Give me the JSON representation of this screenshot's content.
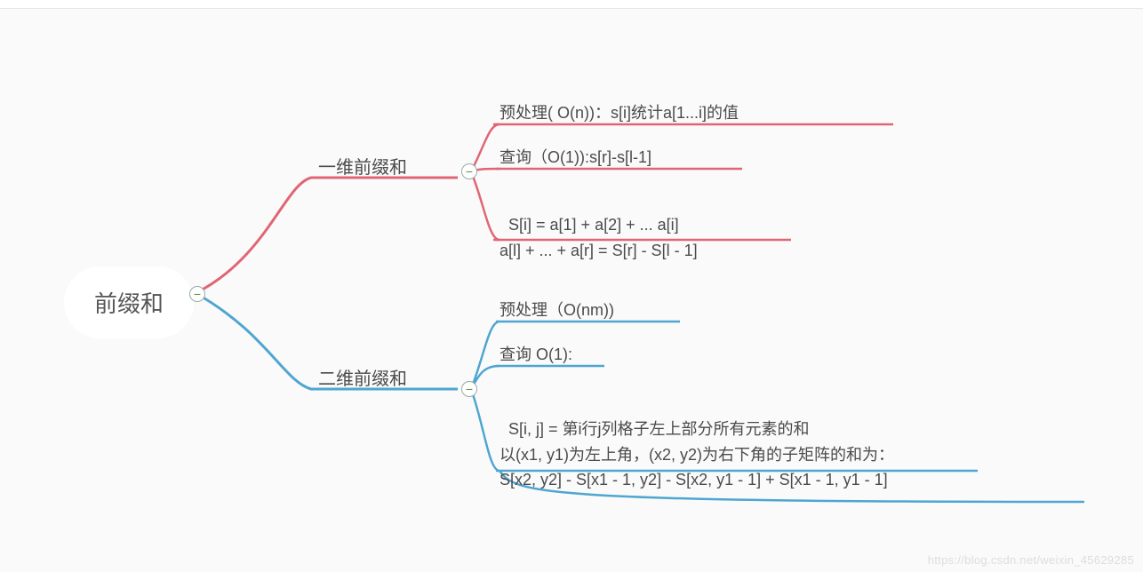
{
  "root": {
    "label": "前缀和"
  },
  "branch1": {
    "label": "一维前缀和",
    "color": "#e06675",
    "leaves": [
      "预处理( O(n))：s[i]统计a[1...i]的值",
      "查询（O(1)):s[r]-s[l-1]",
      "S[i] = a[1] + a[2] + ... a[i]\na[l] + ... + a[r] = S[r] - S[l - 1]"
    ]
  },
  "branch2": {
    "label": "二维前缀和",
    "color": "#4ea6d1",
    "leaves": [
      "预处理（O(nm))",
      "查询 O(1):",
      "S[i, j] = 第i行j列格子左上部分所有元素的和\n以(x1, y1)为左上角，(x2, y2)为右下角的子矩阵的和为：\nS[x2, y2] - S[x1 - 1, y2] - S[x2, y1 - 1] + S[x1 - 1, y1 - 1]"
    ]
  },
  "watermark": "https://blog.csdn.net/weixin_45629285"
}
